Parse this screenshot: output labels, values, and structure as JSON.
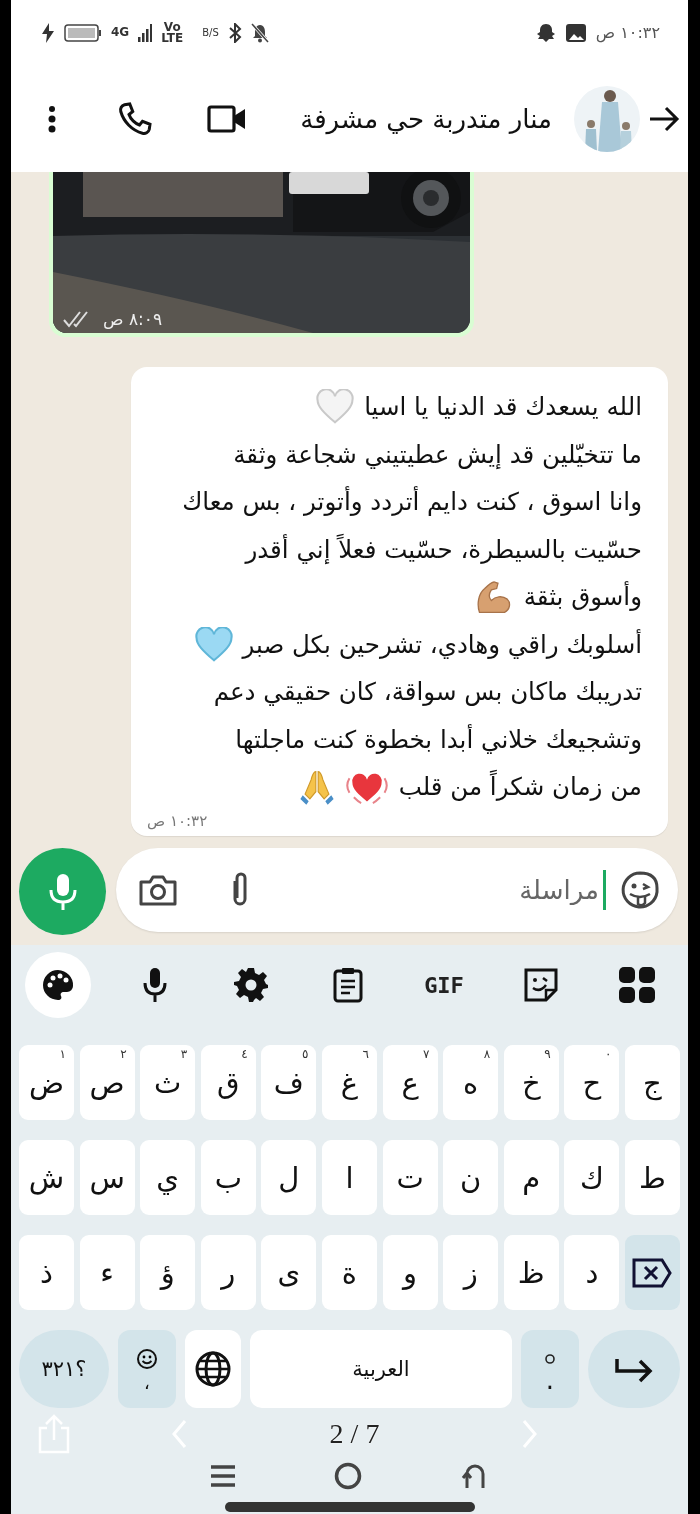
{
  "status_bar": {
    "time": "١٠:٣٢ ص",
    "network": "4G",
    "volte_top": "Vo",
    "volte_bottom": "LTE",
    "speed_unit": "B/S"
  },
  "header": {
    "contact_name": "منار متدربة حي مشرفة"
  },
  "messages": [
    {
      "time": "٨:٠٩ ص"
    },
    {
      "kind": "text",
      "time": "١٠:٣٢ ص",
      "lines": [
        {
          "text": "الله يسعدك قد الدنيا يا اسيا",
          "emoji": [
            {
              "kind": "white-heart"
            }
          ]
        },
        {
          "text": "ما تتخيّلين قد إيش عطيتيني شجاعة وثقة"
        },
        {
          "text": "وانا اسوق ، كنت دايم أتردد وأتوتر ، بس معاك"
        },
        {
          "text": "حسّيت بالسيطرة، حسّيت فعلاً إني أقدر"
        },
        {
          "text": "وأسوق بثقة",
          "emoji": [
            {
              "kind": "flexed-arm"
            }
          ]
        },
        {
          "text": "أسلوبك راقي وهادي، تشرحين بكل صبر",
          "emoji": [
            {
              "kind": "blue-heart"
            }
          ]
        },
        {
          "text": "تدريبك ماكان بس سواقة، كان حقيقي دعم"
        },
        {
          "text": "وتشجيعك خلاني أبدا بخطوة كنت ماجلتها"
        },
        {
          "text": "من زمان شكراً من قلب",
          "emoji": [
            {
              "kind": "beating-heart"
            },
            {
              "kind": "folded-hands"
            }
          ]
        }
      ]
    }
  ],
  "composer": {
    "placeholder": "مراسلة"
  },
  "keyboard": {
    "toolbar": [
      {
        "kind": "palette",
        "selected": true
      },
      {
        "kind": "mic",
        "selected": false
      },
      {
        "kind": "settings",
        "selected": false
      },
      {
        "kind": "clipboard",
        "selected": false
      },
      {
        "kind": "gif",
        "label": "GIF",
        "selected": false
      },
      {
        "kind": "sticker",
        "selected": false
      },
      {
        "kind": "apps",
        "selected": false
      }
    ],
    "rows": [
      [
        {
          "label": "ج"
        },
        {
          "label": "ح",
          "hint": "٠"
        },
        {
          "label": "خ",
          "hint": "٩"
        },
        {
          "label": "ه",
          "hint": "٨"
        },
        {
          "label": "ع",
          "hint": "٧"
        },
        {
          "label": "غ",
          "hint": "٦"
        },
        {
          "label": "ف",
          "hint": "٥"
        },
        {
          "label": "ق",
          "hint": "٤"
        },
        {
          "label": "ث",
          "hint": "٣"
        },
        {
          "label": "ص",
          "hint": "٢"
        },
        {
          "label": "ض",
          "hint": "١"
        }
      ],
      [
        {
          "label": "ط"
        },
        {
          "label": "ك"
        },
        {
          "label": "م"
        },
        {
          "label": "ن"
        },
        {
          "label": "ت"
        },
        {
          "label": "ا"
        },
        {
          "label": "ل"
        },
        {
          "label": "ب"
        },
        {
          "label": "ي"
        },
        {
          "label": "س"
        },
        {
          "label": "ش"
        }
      ],
      [
        {
          "kind": "backspace"
        },
        {
          "label": "د"
        },
        {
          "label": "ظ"
        },
        {
          "label": "ز"
        },
        {
          "label": "و"
        },
        {
          "label": "ة"
        },
        {
          "label": "ى"
        },
        {
          "label": "ر"
        },
        {
          "label": "ؤ"
        },
        {
          "label": "ء"
        },
        {
          "label": "ذ"
        }
      ]
    ],
    "bottom_row": [
      {
        "kind": "symbols",
        "label": "؟٣٢١"
      },
      {
        "kind": "emoji-comma",
        "label": "،"
      },
      {
        "kind": "globe"
      },
      {
        "kind": "space",
        "label": "العربية"
      },
      {
        "kind": "period",
        "label": "."
      },
      {
        "kind": "enter"
      }
    ]
  },
  "gallery": {
    "counter": "2 / 7"
  }
}
